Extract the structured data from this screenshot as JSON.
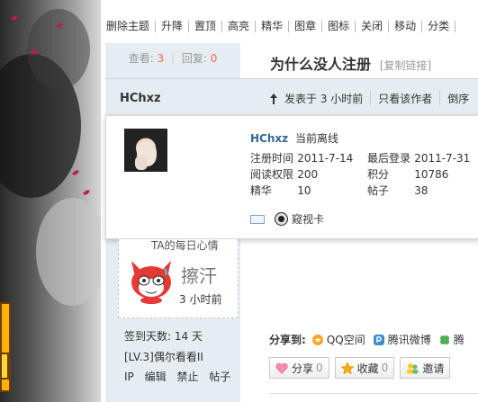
{
  "toolbar": {
    "items": [
      "删除主题",
      "升降",
      "置顶",
      "高亮",
      "精华",
      "图章",
      "图标",
      "关闭",
      "移动",
      "分类"
    ]
  },
  "stats": {
    "views_label": "查看:",
    "views": "3",
    "replies_label": "回复:",
    "replies": "0"
  },
  "thread": {
    "title": "为什么没人注册",
    "copy_link": "[复制链接]"
  },
  "author": {
    "name": "HChxz"
  },
  "post_info": {
    "posted": "发表于 3 小时前",
    "only_author": "只看该作者",
    "reverse": "倒序"
  },
  "profile_card": {
    "name": "HChxz",
    "status": "当前离线",
    "fields": [
      {
        "k1": "注册时间",
        "v1": "2011-7-14",
        "k2": "最后登录",
        "v2": "2011-7-31"
      },
      {
        "k1": "阅读权限",
        "v1": "200",
        "k2": "积分",
        "v2": "10786"
      },
      {
        "k1": "精华",
        "v1": "10",
        "k2": "帖子",
        "v2": "38"
      }
    ],
    "peek": "窥视卡"
  },
  "mood": {
    "title": "TA的每日心情",
    "text": "擦汗",
    "time": "3 小时前"
  },
  "sidebar": {
    "signin": "签到天数: 14 天",
    "level": "[LV.3]偶尔看看II",
    "links": [
      "IP",
      "编辑",
      "禁止",
      "帖子"
    ]
  },
  "share": {
    "label": "分享到:",
    "services": [
      {
        "name": "QQ空间",
        "color": "#f5a623"
      },
      {
        "name": "腾讯微博",
        "color": "#3b8ed0"
      },
      {
        "name": "腾",
        "color": "#4caf50"
      }
    ]
  },
  "actions": {
    "share": "分享",
    "share_count": "0",
    "favorite": "收藏",
    "favorite_count": "0",
    "invite": "邀请"
  },
  "colors": {
    "accent_number": "#f26c4f",
    "panel_bg": "#e5edf2",
    "link_blue": "#336699"
  }
}
